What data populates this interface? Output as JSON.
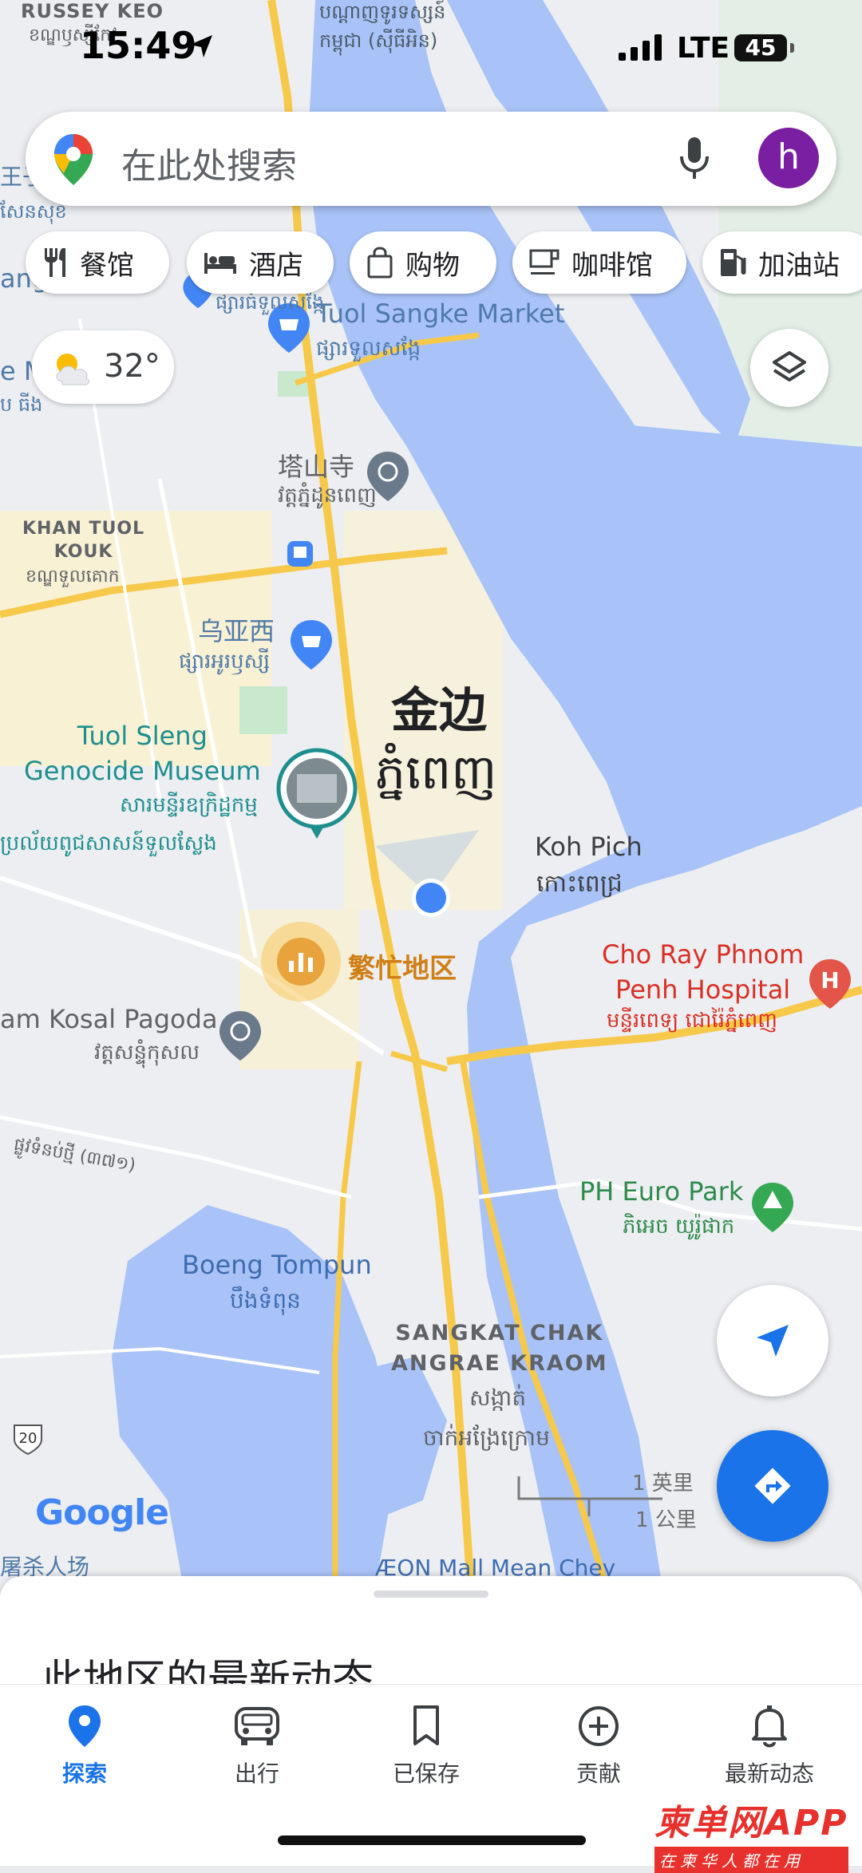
{
  "status_bar": {
    "time": "15:49",
    "network": "LTE",
    "battery": "45"
  },
  "search": {
    "placeholder": "在此处搜索",
    "avatar_letter": "h"
  },
  "chips": [
    {
      "label": "餐馆",
      "icon": "fork-knife-icon"
    },
    {
      "label": "酒店",
      "icon": "bed-icon"
    },
    {
      "label": "购物",
      "icon": "shopping-bag-icon"
    },
    {
      "label": "咖啡馆",
      "icon": "coffee-cup-icon"
    },
    {
      "label": "加油站",
      "icon": "gas-pump-icon"
    }
  ],
  "weather": {
    "temperature": "32°",
    "icon": "partly-cloudy-icon"
  },
  "map_labels": {
    "russey_keo": "RUSSEY KEO",
    "russey_keo_kh": "ខណ្ឌឫស្សីកែវ",
    "top_kh_1": "បណ្ដាញទូរទស្សន៍",
    "top_kh_2": "កម្ពុជា (ស៊ីធីអិន)",
    "left_edge_1": "王子",
    "left_edge_2": "សែនសុខ",
    "left_edge_3": "ang",
    "left_edge_4": "e M",
    "left_edge_5": "ប ធីង",
    "tuol_sangke_kh_small": "ផ្សារធំទួលសង្កែ",
    "tuol_sangke_market": "Tuol Sangke Market",
    "tuol_sangke_market_kh": "ផ្សារទួលសង្កែ",
    "wat_phnom_cn": "塔山寺",
    "wat_phnom_kh": "វត្តភ្នំដូនពេញ",
    "khan_tuol_kouk": "KHAN TUOL\nKOUK",
    "khan_tuol_kouk_kh": "ខណ្ឌទួលគោក",
    "oreussey_cn": "乌亚西",
    "oreussey_kh": "ផ្សារអូរឫស្សី",
    "city_cn": "金边",
    "city_kh": "ភ្នំពេញ",
    "tuol_sleng": "Tuol Sleng\nGenocide Museum",
    "tuol_sleng_kh_1": "សារមន្ទីរឧក្រិដ្ឋកម្ម",
    "tuol_sleng_kh_2": "ប្រល័យពូជសាសន៍ទួលស្លែង",
    "koh_pich": "Koh Pich",
    "koh_pich_kh": "កោះពេជ្រ",
    "busy_area": "繁忙地区",
    "cho_ray": "Cho Ray Phnom\nPenh Hospital",
    "cho_ray_kh": "មន្ទីរពេទ្យ ជោរ៉ៃភ្នំពេញ",
    "pagoda": "am Kosal Pagoda",
    "pagoda_kh": "វត្តសន្ទុំកុសល",
    "street_kh": "ផ្លូវទំនប់ថ្មី (៣៧១)",
    "ph_euro_park": "PH Euro Park",
    "ph_euro_park_kh": "ភិអេច យូរ៉ូផាក",
    "boeng_tompun": "Boeng Tompun",
    "boeng_tompun_kh": "បឹងទំពុន",
    "sangkat": "SANGKAT CHAK\nANGRAE KRAOM",
    "sangkat_kh_1": "សង្កាត់",
    "sangkat_kh_2": "ចាក់អង្រែក្រោម",
    "route_20": "20",
    "aeon": "ÆON Mall Mean Chey",
    "bottom_left": "屠杀人场",
    "google_logo": "Google",
    "scale_mi": "1 英里",
    "scale_km": "1 公里"
  },
  "sheet": {
    "title": "此地区的最新动态"
  },
  "bottom_nav": [
    {
      "label": "探索",
      "icon": "location-pin-icon",
      "active": true
    },
    {
      "label": "出行",
      "icon": "car-icon",
      "active": false
    },
    {
      "label": "已保存",
      "icon": "bookmark-icon",
      "active": false
    },
    {
      "label": "贡献",
      "icon": "add-circle-icon",
      "active": false
    },
    {
      "label": "最新动态",
      "icon": "bell-icon",
      "active": false
    }
  ],
  "watermark": {
    "brand": "柬单网APP",
    "tagline": "在柬华人都在用"
  },
  "colors": {
    "water": "#a9c3f8",
    "road": "#fbd26a",
    "accent": "#1a73e8",
    "busy": "#e8a33d",
    "hospital": "#e25548",
    "park": "#34a853"
  }
}
